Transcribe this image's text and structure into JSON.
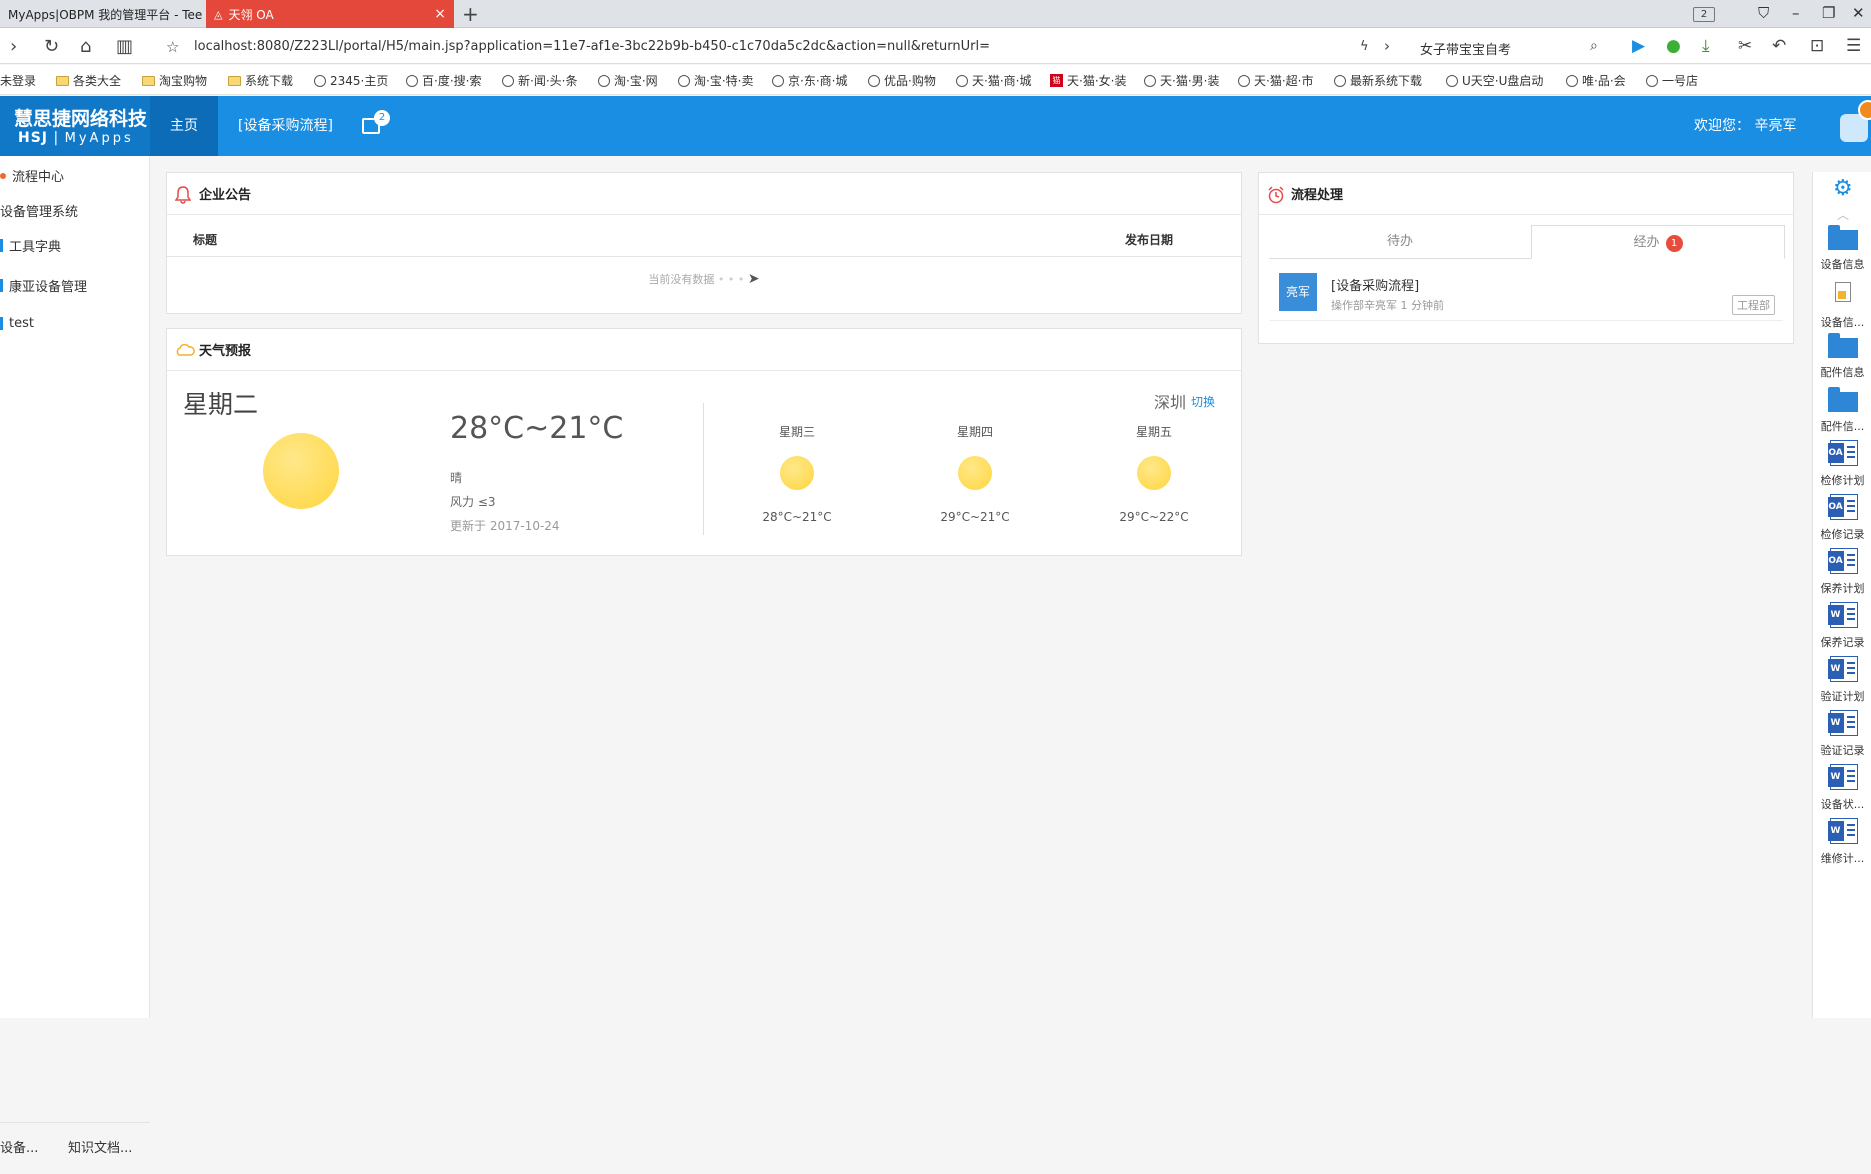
{
  "browser": {
    "tabs": [
      {
        "label": "MyApps|OBPM 我的管理平台 - Tee"
      },
      {
        "label": "天翎 OA"
      }
    ],
    "tab_count": "2",
    "url": "localhost:8080/Z223LI/portal/H5/main.jsp?application=11e7-af1e-3bc22b9b-b450-c1c70da5c2dc&action=null&returnUrl=",
    "search_text": "女子带宝宝自考",
    "bookmarks": [
      {
        "label": "未登录",
        "icon": "none"
      },
      {
        "label": "各类大全",
        "icon": "folder"
      },
      {
        "label": "淘宝购物",
        "icon": "folder"
      },
      {
        "label": "系统下载",
        "icon": "folder"
      },
      {
        "label": "2345·主页",
        "icon": "globe"
      },
      {
        "label": "百·度·搜·索",
        "icon": "globe"
      },
      {
        "label": "新·闻·头·条",
        "icon": "globe"
      },
      {
        "label": "淘·宝·网",
        "icon": "globe"
      },
      {
        "label": "淘·宝·特·卖",
        "icon": "globe"
      },
      {
        "label": "京·东·商·城",
        "icon": "globe"
      },
      {
        "label": "优品·购物",
        "icon": "globe"
      },
      {
        "label": "天·猫·商·城",
        "icon": "globe"
      },
      {
        "label": "天·猫·女·装",
        "icon": "tmall"
      },
      {
        "label": "天·猫·男·装",
        "icon": "globe"
      },
      {
        "label": "天·猫·超·市",
        "icon": "globe"
      },
      {
        "label": "最新系统下载",
        "icon": "globe"
      },
      {
        "label": "U天空·U盘启动",
        "icon": "globe"
      },
      {
        "label": "唯·品·会",
        "icon": "globe"
      },
      {
        "label": "一号店",
        "icon": "globe"
      }
    ]
  },
  "header": {
    "logo_main": "慧思捷网络科技",
    "logo_sub_a": "HSJ",
    "logo_sub_b": "MyApps",
    "nav_home": "主页",
    "nav_process": "[设备采购流程]",
    "message_count": "2",
    "welcome": "欢迎您：  辛亮军"
  },
  "sidebar": {
    "items": [
      {
        "label": "流程中心"
      },
      {
        "label": "设备管理系统"
      },
      {
        "label": "工具字典"
      },
      {
        "label": "康亚设备管理"
      },
      {
        "label": "test"
      }
    ],
    "bottom_tabs": [
      {
        "label": "设备..."
      },
      {
        "label": "知识文档..."
      }
    ]
  },
  "notice": {
    "title": "企业公告",
    "col_title": "标题",
    "col_date": "发布日期",
    "empty_text": "当前没有数据"
  },
  "weather": {
    "title": "天气预报",
    "today": "星期二",
    "temp": "28°C~21°C",
    "condition": "晴",
    "wind": "风力 ≤3",
    "updated": "更新于 2017-10-24",
    "city": "深圳",
    "switch": "切换",
    "forecast": [
      {
        "day": "星期三",
        "range": "28°C~21°C"
      },
      {
        "day": "星期四",
        "range": "29°C~21°C"
      },
      {
        "day": "星期五",
        "range": "29°C~22°C"
      }
    ]
  },
  "process": {
    "title": "流程处理",
    "tab_todo": "待办",
    "tab_done": "经办",
    "done_count": "1",
    "item": {
      "avatar": "亮军",
      "title": "[设备采购流程]",
      "meta": "操作部辛亮军 1 分钟前",
      "dept": "工程部"
    }
  },
  "rightbar": {
    "items": [
      {
        "label": "设备信息",
        "icon": "folder"
      },
      {
        "label": "设备信...",
        "icon": "doc"
      },
      {
        "label": "配件信息",
        "icon": "folder"
      },
      {
        "label": "配件信...",
        "icon": "folder"
      },
      {
        "label": "检修计划",
        "icon": "oa"
      },
      {
        "label": "检修记录",
        "icon": "oa"
      },
      {
        "label": "保养计划",
        "icon": "oa"
      },
      {
        "label": "保养记录",
        "icon": "word"
      },
      {
        "label": "验证计划",
        "icon": "word"
      },
      {
        "label": "验证记录",
        "icon": "word"
      },
      {
        "label": "设备状...",
        "icon": "word"
      },
      {
        "label": "维修计...",
        "icon": "word"
      }
    ]
  },
  "colors": {
    "primary": "#1a8ee2",
    "primary_dark": "#0c6cb8",
    "active_tab": "#e4483b",
    "badge": "#e74c3c"
  }
}
